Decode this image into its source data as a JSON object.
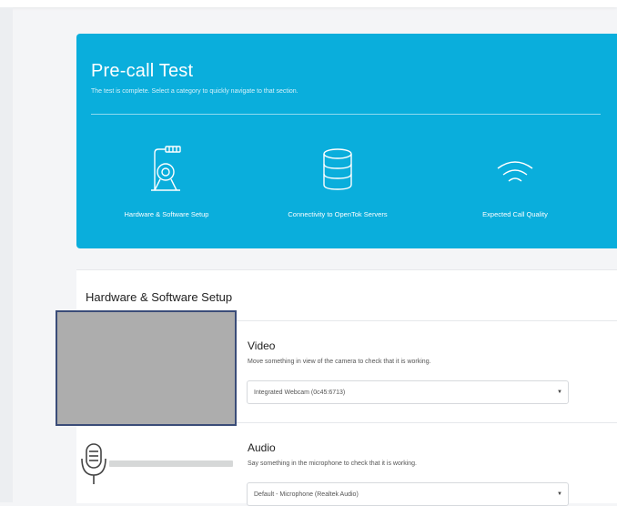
{
  "hero": {
    "title": "Pre-call Test",
    "subtitle": "The test is complete. Select a category to quickly navigate to that section.",
    "background_color": "#0aaedc",
    "categories": [
      {
        "label": "Hardware & Software Setup",
        "icon": "camera-icon"
      },
      {
        "label": "Connectivity to OpenTok Servers",
        "icon": "database-icon"
      },
      {
        "label": "Expected Call Quality",
        "icon": "wifi-icon"
      }
    ]
  },
  "section": {
    "title": "Hardware & Software Setup",
    "video": {
      "title": "Video",
      "description": "Move something in view of the camera to check that it is working.",
      "select_value": "Integrated Webcam (0c45:6713)"
    },
    "audio": {
      "title": "Audio",
      "description": "Say something in the microphone to check that it is working.",
      "select_value": "Default - Microphone (Realtek Audio)",
      "icon": "microphone-icon"
    }
  }
}
